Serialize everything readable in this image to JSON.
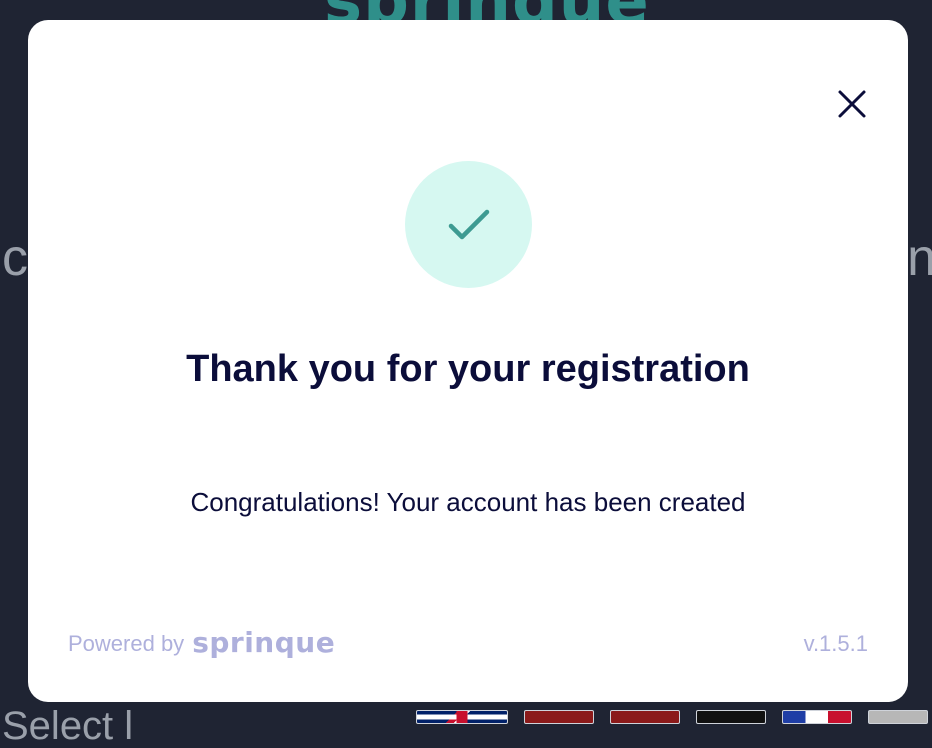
{
  "background": {
    "logo_text": "sprinque",
    "left_fragment": "c",
    "right_fragment": "n",
    "bottom_fragment": "Select l",
    "language_flags": [
      "uk-flag",
      "red-flag",
      "red-flag",
      "dark-flag",
      "fr-flag",
      "grey-flag"
    ]
  },
  "modal": {
    "close_icon": "close-icon",
    "success_icon": "checkmark-icon",
    "title": "Thank you for your registration",
    "message": "Congratulations! Your account has been created",
    "footer": {
      "powered_by": "Powered by",
      "brand": "sprinque",
      "version": "v.1.5.1"
    }
  },
  "colors": {
    "overlay_background": "#1f2433",
    "modal_background": "#ffffff",
    "title_color": "#0b0d3a",
    "success_circle": "#d6f8f1",
    "check_color": "#3e9b92",
    "footer_color": "#aeb0dc"
  }
}
